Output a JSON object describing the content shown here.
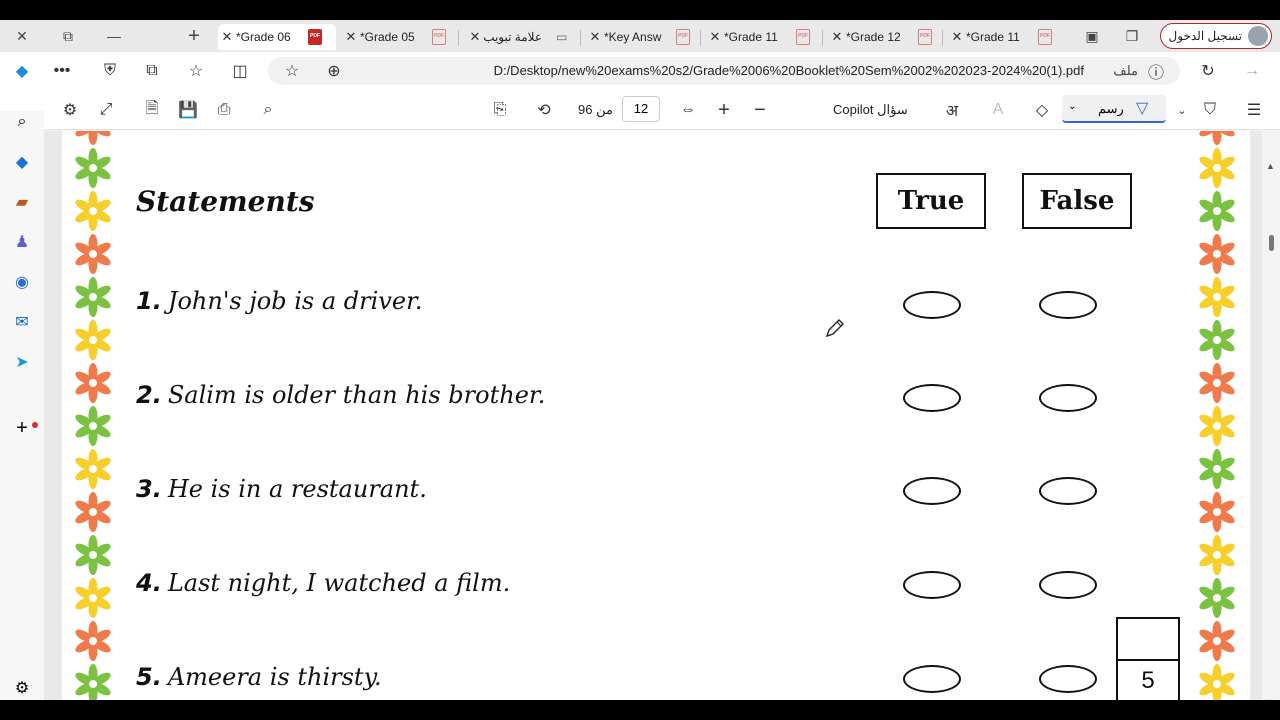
{
  "tabs": [
    {
      "label": "*Grade 06",
      "active": true
    },
    {
      "label": "*Grade 05",
      "active": false
    },
    {
      "label": "علامة تبويب",
      "active": false
    },
    {
      "label": "*Key Answ",
      "active": false
    },
    {
      "label": "*Grade 11",
      "active": false
    },
    {
      "label": "*Grade 12",
      "active": false
    },
    {
      "label": "*Grade 11",
      "active": false
    }
  ],
  "signin_label": "تسجيل الدخول",
  "address": {
    "url": "D:/Desktop/new%20exams%20s2/Grade%2006%20Booklet%20Sem%2002%202023-2024%20(1).pdf",
    "file_label": "ملف"
  },
  "pdf_toolbar": {
    "page_of_label": "من 96",
    "current_page": "12",
    "copilot_label": "Copilot سؤال",
    "draw_label": "رسم"
  },
  "worksheet": {
    "heading": "Statements",
    "true_label": "True",
    "false_label": "False",
    "statements": [
      {
        "num": "1.",
        "text": "John's job is a driver."
      },
      {
        "num": "2.",
        "text": "Salim is older than his brother."
      },
      {
        "num": "3.",
        "text": "He is in a restaurant."
      },
      {
        "num": "4.",
        "text": "Last night, I watched a film."
      },
      {
        "num": "5.",
        "text": "Ameera is thirsty."
      }
    ],
    "score_value": "5"
  },
  "colors": {
    "flower_orange": "#ef7a4b",
    "flower_green": "#7cc242",
    "flower_yellow": "#f6cf2a",
    "signin_border": "#b3262e",
    "accent": "#3367d6"
  }
}
